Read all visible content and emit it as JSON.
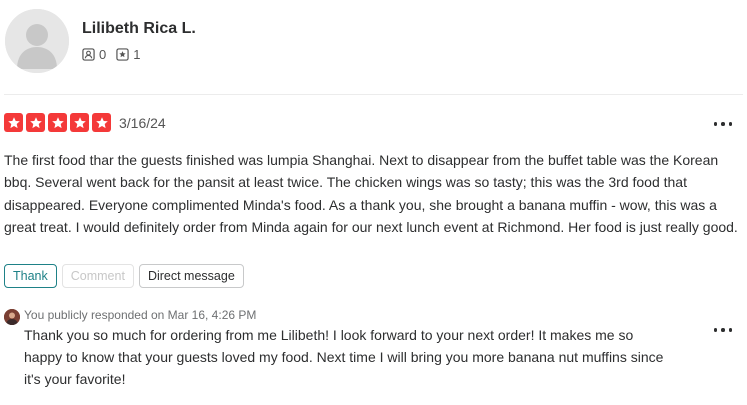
{
  "user": {
    "name": "Lilibeth Rica L.",
    "friends_count": "0",
    "reviews_count": "1"
  },
  "review": {
    "rating": 5,
    "max_rating": 5,
    "date": "3/16/24",
    "text": "The first food thar the guests finished was lumpia Shanghai. Next to disappear from the buffet table was the Korean bbq. Several went back for the pansit at least twice. The chicken wings was so tasty; this was the 3rd food that disappeared. Everyone complimented Minda's food. As a thank you, she brought a banana muffin - wow, this was a great treat. I would definitely order from Minda again for our next lunch event at Richmond. Her food is just really good."
  },
  "actions": {
    "thank_label": "Thank",
    "comment_label": "Comment",
    "direct_message_label": "Direct message"
  },
  "response": {
    "meta": "You publicly responded on Mar 16, 4:26 PM",
    "text": "Thank you so much for ordering from me Lilibeth! I look forward to your next order! It makes me so happy to know that your guests loved my food. Next time I will bring you more banana nut muffins since it's your favorite!"
  },
  "colors": {
    "star_red": "#f43939",
    "accent_teal": "#1e8187",
    "text_dark": "#2d2e2f"
  },
  "icons": {
    "avatar": "user-silhouette-icon",
    "friends": "friends-icon",
    "reviews": "reviews-star-icon",
    "more": "more-options-icon",
    "star": "star-icon"
  }
}
